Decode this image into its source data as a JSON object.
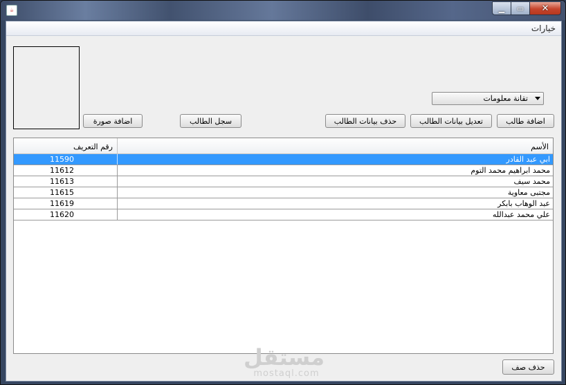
{
  "window": {
    "icon": "java-cup-icon",
    "controls": {
      "minimize": "▁",
      "maximize": "▭",
      "close": "✕"
    }
  },
  "menu": {
    "items": [
      "خيارات"
    ]
  },
  "photo": {
    "icon": "image-placeholder"
  },
  "buttons": {
    "add_photo": "اضافة صورة",
    "student_record": "سجل الطالب",
    "delete_student": "حذف بيانات الطالب",
    "edit_student": "تعديل بيانات الطالب",
    "add_student": "اضافة طالب",
    "delete_row": "حذف صف"
  },
  "department": {
    "selected": "تقانة معلومات"
  },
  "table": {
    "columns": {
      "id": "رقم التعريف",
      "name": "الأسم"
    },
    "rows": [
      {
        "id": "11590",
        "name": "ابي عبد القادر"
      },
      {
        "id": "11612",
        "name": "محمد ابراهيم محمد التوم"
      },
      {
        "id": "11613",
        "name": "محمد سيف"
      },
      {
        "id": "11615",
        "name": "مجتبى معاوية"
      },
      {
        "id": "11619",
        "name": "عبد الوهاب بابكر"
      },
      {
        "id": "11620",
        "name": "علي محمد عبدالله"
      }
    ],
    "selected_index": 0
  },
  "watermark": {
    "arabic": "مستقل",
    "latin": "mostaql.com"
  },
  "colors": {
    "selection": "#3399ff",
    "close_button": "#c6452c",
    "background": "#efefef"
  }
}
